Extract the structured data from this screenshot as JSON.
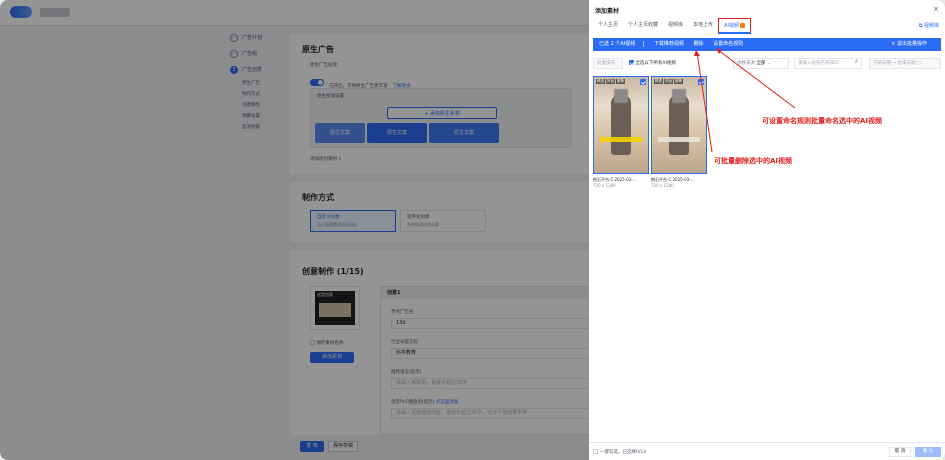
{
  "steps": {
    "items": [
      {
        "mark": "✓",
        "label": "广告计划"
      },
      {
        "mark": "✓",
        "label": "广告组"
      },
      {
        "mark": "3",
        "label": "广告创意"
      }
    ],
    "subitems": [
      "原生广告",
      "制作方式",
      "创意制作",
      "预算设置",
      "监测链接"
    ]
  },
  "native": {
    "title": "原生广告",
    "toggle_label": "原生广告投放",
    "toggle_desc": "已开启，可将原生广告更丰富",
    "learn_more": "了解更多",
    "table_header": "原生投放设置",
    "add_material": "+ 添加原生素材",
    "cells": [
      "原生文案",
      "原生文案",
      "原生文案"
    ],
    "add_more": "添加原创素材 ∨"
  },
  "production": {
    "title": "制作方式",
    "option1": "自定义创意",
    "option1_desc": "自己选择素材进行组合",
    "option2": "程序化创意",
    "option2_desc": "系统自动组合创意"
  },
  "creative": {
    "title": "创意制作 (1/15)",
    "set_label": "创意1",
    "thumb_label": "这是创意",
    "save_name": "保存素材名称",
    "add_btn": "添加素材",
    "ad_name_label": "节点广告名",
    "ad_name_value": "13d",
    "industry_label": "行业号提交权",
    "industry_value": "科学教育",
    "copy_label": "推荐语言(提示)",
    "copy_placeholder": "请输入推荐语，长度不超过30字",
    "plc_label": "语音PLC播放语(提示)",
    "plc_link": "点这里添加",
    "plc_placeholder": "请输入语音播放内容，建议不超过30字，句子不能有数字等"
  },
  "bottom": {
    "publish": "发 布",
    "draft": "保存草稿"
  },
  "drawer": {
    "title": "添加素材",
    "close": "×",
    "tabs": [
      "个人主页",
      "个人主页收藏",
      "视频库",
      "本地上传",
      "AI视频"
    ],
    "lib_link": "视频库",
    "bulk_selected": "已选 2 个AI视频",
    "bulk_download": "下载推荐视频",
    "bulk_delete": "删除",
    "bulk_rename": "设置命名规则",
    "bulk_exit": "× 退出批量操作",
    "filter_batch": "批量操作",
    "filter_checkall": "全选以下所有AI视频",
    "filter_source_label": "视频来源",
    "filter_source_value": "全部",
    "filter_search": "请输入视频名称或ID",
    "filter_date_start": "开始日期",
    "filter_date_sep": "→",
    "filter_date_end": "结束日期",
    "cards": [
      {
        "tags": [
          "精选",
          "好运",
          "推荐"
        ],
        "name": "抱石平台-C 2025-03-...",
        "size": "720 x 1280"
      },
      {
        "tags": [
          "精选",
          "好运",
          "推荐"
        ],
        "name": "抱石平台-C 2025-03-...",
        "size": "720 x 1280"
      }
    ],
    "footer_left": "一键勾选，已选择0/14",
    "cancel": "取 消",
    "confirm": "确 认"
  },
  "annotations": {
    "rename": "可设置命名规则批量命名选中的AI视频",
    "delete": "可批量删除选中的AI视频"
  }
}
